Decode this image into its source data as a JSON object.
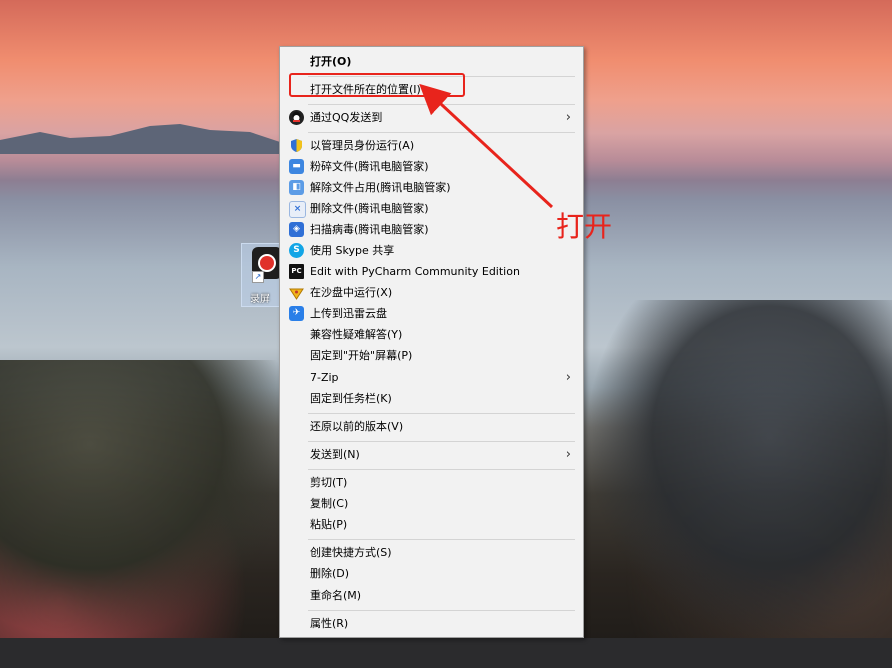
{
  "desktop_icon": {
    "label": "录屏",
    "icon": "screen-recorder-app-icon"
  },
  "menu": {
    "items": [
      {
        "label": "打开(O)",
        "bold": true
      },
      {
        "label": "打开文件所在的位置(I)"
      },
      {
        "label": "通过QQ发送到",
        "icon": "qq-icon",
        "submenu": true
      },
      {
        "label": "以管理员身份运行(A)",
        "icon": "shield-icon"
      },
      {
        "label": "粉碎文件(腾讯电脑管家)",
        "icon": "shred-file-icon"
      },
      {
        "label": "解除文件占用(腾讯电脑管家)",
        "icon": "unlock-file-icon"
      },
      {
        "label": "删除文件(腾讯电脑管家)",
        "icon": "delete-file-icon"
      },
      {
        "label": "扫描病毒(腾讯电脑管家)",
        "icon": "virus-scan-icon"
      },
      {
        "label": "使用 Skype 共享",
        "icon": "skype-icon"
      },
      {
        "label": "Edit with PyCharm Community Edition",
        "icon": "pycharm-icon"
      },
      {
        "label": "在沙盘中运行(X)",
        "icon": "sandbox-icon"
      },
      {
        "label": "上传到迅雷云盘",
        "icon": "thunder-cloud-icon"
      },
      {
        "label": "兼容性疑难解答(Y)"
      },
      {
        "label": "固定到\"开始\"屏幕(P)"
      },
      {
        "label": "7-Zip",
        "submenu": true
      },
      {
        "label": "固定到任务栏(K)"
      },
      {
        "label": "还原以前的版本(V)"
      },
      {
        "label": "发送到(N)",
        "submenu": true
      },
      {
        "label": "剪切(T)"
      },
      {
        "label": "复制(C)"
      },
      {
        "label": "粘贴(P)"
      },
      {
        "label": "创建快捷方式(S)"
      },
      {
        "label": "删除(D)"
      },
      {
        "label": "重命名(M)"
      },
      {
        "label": "属性(R)"
      }
    ],
    "submenu_arrow": "›"
  },
  "annotation": {
    "text": "打开",
    "color": "#e8241c"
  }
}
